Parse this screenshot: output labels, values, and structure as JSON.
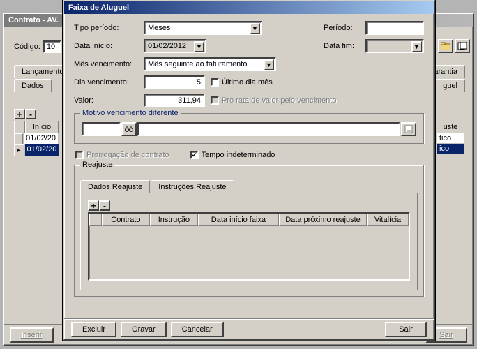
{
  "background_window": {
    "title": "Contrato - AV.",
    "codigo_label": "Código:",
    "codigo_value": "10",
    "tabs_row1": [
      "Lançamento",
      "Garantia"
    ],
    "tabs_row2": [
      "Dados",
      "guel"
    ],
    "grid": {
      "header": "Início",
      "rows": [
        "01/02/20",
        "01/02/20"
      ]
    },
    "side_col": {
      "header": "uste",
      "rows": [
        "tico",
        "ico"
      ]
    },
    "buttons": {
      "inserir": "Inserir",
      "sair": "Sair"
    }
  },
  "front_window": {
    "title": "Faixa de Aluguel",
    "labels": {
      "tipo_periodo": "Tipo período:",
      "data_inicio": "Data início:",
      "mes_venc": "Mês vencimento:",
      "dia_venc": "Dia vencimento:",
      "valor": "Valor:",
      "periodo": "Período:",
      "data_fim": "Data fim:"
    },
    "values": {
      "tipo_periodo": "Meses",
      "data_inicio": "01/02/2012",
      "mes_venc": "Mês seguinte ao faturamento",
      "dia_venc": "5",
      "valor": "311,94",
      "periodo": "",
      "data_fim": ""
    },
    "checkboxes": {
      "ultimo_dia": "Último dia mês",
      "pro_rata": "Pro rata de valor pelo vencimento",
      "prorrogacao": "Prorrogação de contrato",
      "tempo_indet": "Tempo indeterminado"
    },
    "motivo_legend": "Motivo vencimento diferente",
    "reajuste_legend": "Reajuste",
    "tabs": {
      "dados": "Dados Reajuste",
      "instrucoes": "Instruções Reajuste"
    },
    "grid_headers": {
      "contrato": "Contrato",
      "instrucao": "Instrução",
      "data_inicio_faixa": "Data início faixa",
      "data_prox": "Data próximo reajuste",
      "vitalicia": "Vitalícia"
    },
    "buttons": {
      "excluir": "Excluir",
      "gravar": "Gravar",
      "cancelar": "Cancelar",
      "sair": "Sair"
    }
  }
}
